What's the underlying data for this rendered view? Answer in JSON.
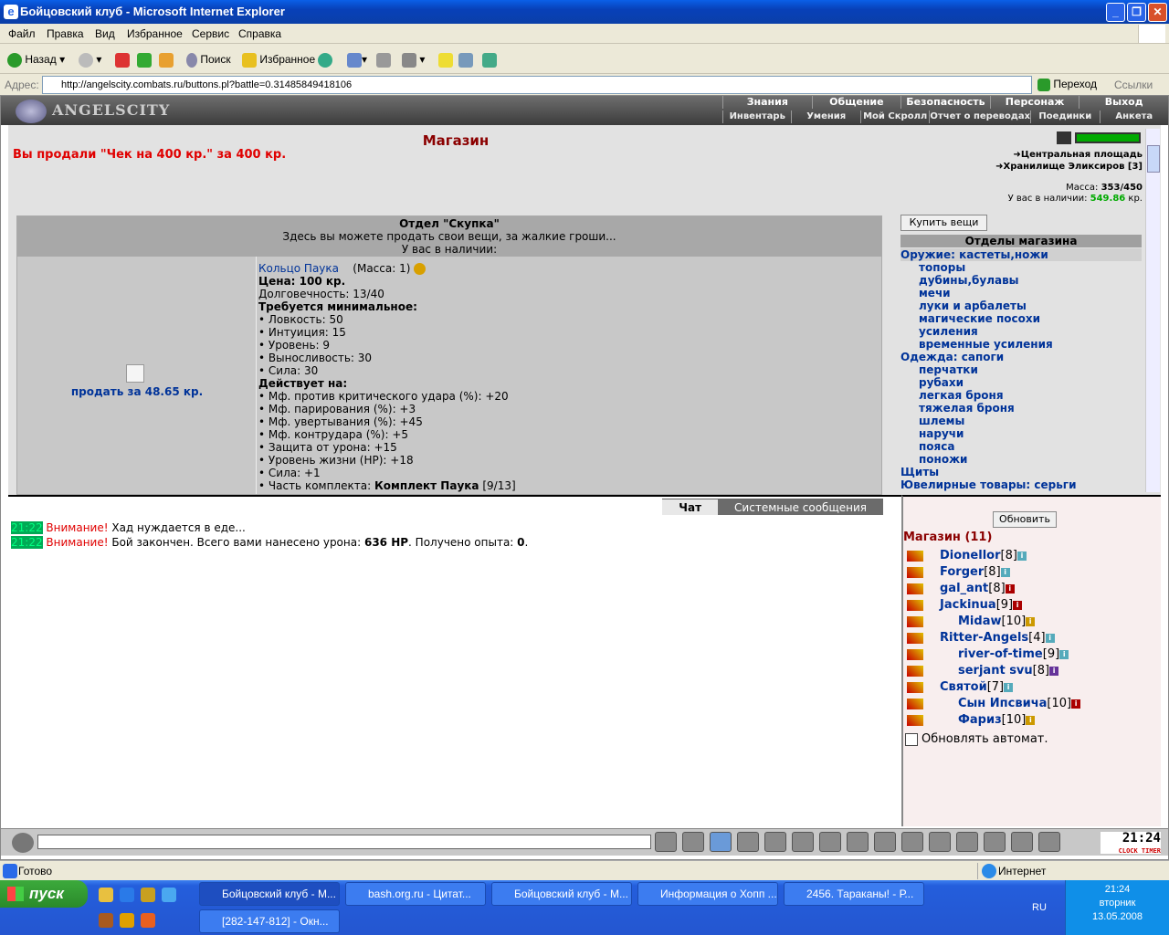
{
  "window": {
    "title": "Бойцовский клуб - Microsoft Internet Explorer"
  },
  "menu": [
    "Файл",
    "Правка",
    "Вид",
    "Избранное",
    "Сервис",
    "Справка"
  ],
  "toolbar": {
    "back": "Назад",
    "search": "Поиск",
    "favorites": "Избранное"
  },
  "address": {
    "label": "Адрес:",
    "url": "http://angelscity.combats.ru/buttons.pl?battle=0.31485849418106",
    "go": "Переход",
    "links": "Ссылки"
  },
  "header": {
    "logo": "ANGELSCITY",
    "nav_top": [
      "Знания",
      "Общение",
      "Безопасность",
      "Персонаж",
      "Выход"
    ],
    "nav_bottom": [
      "Инвентарь",
      "Умения",
      "Мой Скролл",
      "Отчет о переводах",
      "Поединки",
      "Анкета"
    ]
  },
  "shop": {
    "title": "Магазин",
    "sold_msg": "Вы продали \"Чек на 400 кр.\" за 400 кр.",
    "locations": [
      "Центральная площадь",
      "Хранилище Эликсиров [3]"
    ],
    "mass_label": "Масса:",
    "mass_value": "353/450",
    "money_label": "У вас в наличии:",
    "money_value": "549.86",
    "money_unit": "кр."
  },
  "dept": {
    "title": "Отдел \"Скупка\"",
    "subtitle": "Здесь вы можете продать свои вещи, за жалкие гроши...",
    "have": "У вас в наличии:",
    "sell_label": "продать за 48.65 кр.",
    "item": {
      "name": "Кольцо Паука",
      "mass": "(Масса: 1)",
      "price": "Цена: 100 кр.",
      "durability": "Долговечность: 13/40",
      "req_head": "Требуется минимальное:",
      "reqs": [
        "• Ловкость: 50",
        "• Интуиция: 15",
        "• Уровень: 9",
        "• Выносливость: 30",
        "• Сила: 30"
      ],
      "acts_head": "Действует на:",
      "acts": [
        "• Мф. против критического удара (%): +20",
        "• Мф. парирования (%): +3",
        "• Мф. увертывания (%): +45",
        "• Мф. контрудара (%): +5",
        "• Защита от урона: +15",
        "• Уровень жизни (HP): +18",
        "• Сила: +1"
      ],
      "set_prefix": "• Часть комплекта:",
      "set_name": "Комплект Паука",
      "set_count": "[9/13]"
    }
  },
  "shop_menu": {
    "buy": "Купить вещи",
    "head": "Отделы магазина",
    "items": [
      {
        "t": "Оружие: кастеты,ножи",
        "sub": false,
        "hl": true
      },
      {
        "t": "топоры",
        "sub": true
      },
      {
        "t": "дубины,булавы",
        "sub": true
      },
      {
        "t": "мечи",
        "sub": true
      },
      {
        "t": "луки и арбалеты",
        "sub": true
      },
      {
        "t": "магические посохи",
        "sub": true
      },
      {
        "t": "усиления",
        "sub": true
      },
      {
        "t": "временные усиления",
        "sub": true
      },
      {
        "t": "Одежда: сапоги",
        "sub": false
      },
      {
        "t": "перчатки",
        "sub": true
      },
      {
        "t": "рубахи",
        "sub": true
      },
      {
        "t": "легкая броня",
        "sub": true
      },
      {
        "t": "тяжелая броня",
        "sub": true
      },
      {
        "t": "шлемы",
        "sub": true
      },
      {
        "t": "наручи",
        "sub": true
      },
      {
        "t": "пояса",
        "sub": true
      },
      {
        "t": "поножи",
        "sub": true
      },
      {
        "t": "Щиты",
        "sub": false
      },
      {
        "t": "Ювелирные товары: серьги",
        "sub": false
      }
    ]
  },
  "chat": {
    "tabs": [
      "Чат",
      "Системные сообщения"
    ],
    "messages": [
      {
        "time": "21:22",
        "warn": "Внимание!",
        "text": " Хад нуждается в еде..."
      },
      {
        "time": "21:22",
        "warn": "Внимание!",
        "text": " Бой закончен. Всего вами нанесено урона: ",
        "b1": "636 HP",
        "t2": ". Получено опыта: ",
        "b2": "0",
        "t3": "."
      }
    ]
  },
  "users": {
    "refresh": "Обновить",
    "title": "Магазин (11)",
    "list": [
      {
        "n": "Dionellor",
        "l": "[8]",
        "i": "b"
      },
      {
        "n": "Forger",
        "l": "[8]",
        "i": "b"
      },
      {
        "n": "gal_ant",
        "l": "[8]",
        "i": "r"
      },
      {
        "n": "Jackinua",
        "l": "[9]",
        "i": "r"
      },
      {
        "n": "Midaw",
        "l": "[10]",
        "i": "y",
        "pad": true
      },
      {
        "n": "Ritter-Angels",
        "l": "[4]",
        "i": "b"
      },
      {
        "n": "river-of-time",
        "l": "[9]",
        "i": "b",
        "pad": true
      },
      {
        "n": "serjant svu",
        "l": "[8]",
        "i": "p",
        "pad": true
      },
      {
        "n": "Святой",
        "l": "[7]",
        "i": "b"
      },
      {
        "n": "Сын Ипсвича",
        "l": "[10]",
        "i": "r",
        "pad": true
      },
      {
        "n": "Фариз",
        "l": "[10]",
        "i": "y",
        "pad": true
      }
    ],
    "auto": "Обновлять автомат."
  },
  "clock": {
    "time": "21:24",
    "label": "CLOCK TIMER"
  },
  "status": {
    "text": "Готово",
    "zone": "Интернет"
  },
  "taskbar": {
    "start": "пуск",
    "buttons": [
      "Бойцовский клуб - М...",
      "bash.org.ru - Цитат...",
      "Бойцовский клуб - М...",
      "Информация о Хопп ...",
      "2456. Тараканы! - Р...",
      "[282-147-812] - Окн..."
    ],
    "lang": "RU",
    "time": "21:24",
    "day": "вторник",
    "date": "13.05.2008"
  }
}
